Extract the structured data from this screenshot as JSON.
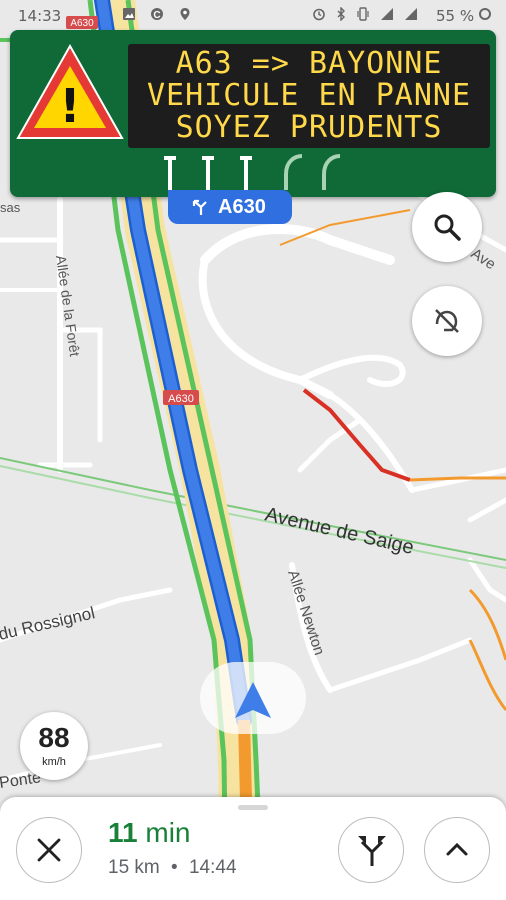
{
  "status_bar": {
    "time": "14:33",
    "battery": "55 %"
  },
  "vms_sign": {
    "line1": "A63 => BAYONNE",
    "line2": "VEHICULE EN PANNE",
    "line3": "SOYEZ PRUDENTS",
    "warning_symbol": "!"
  },
  "route_shield": {
    "label": "A630",
    "icon": "fork-left-icon"
  },
  "map_labels": {
    "avenue_saige": "Avenue de Saige",
    "allee_newton": "Allée Newton",
    "allee_foret": "Allée de la Forêt",
    "rossignol": "du Rossignol",
    "ponte": "Ponte",
    "ave_right": "Ave",
    "asas": "sas",
    "a630_top": "A630",
    "a630_mid": "A630"
  },
  "speed": {
    "value": "88",
    "unit": "km/h"
  },
  "eta": {
    "number": "11",
    "unit": "min",
    "distance": "15 km",
    "separator": "•",
    "arrival": "14:44"
  },
  "colors": {
    "route_blue": "#3f7ee8",
    "traffic_green": "#5bc35b",
    "traffic_red": "#d93025",
    "traffic_orange": "#f29a2e",
    "eta_green": "#188038",
    "vms_green": "#0f6a38",
    "vms_text": "#ffd94a"
  }
}
